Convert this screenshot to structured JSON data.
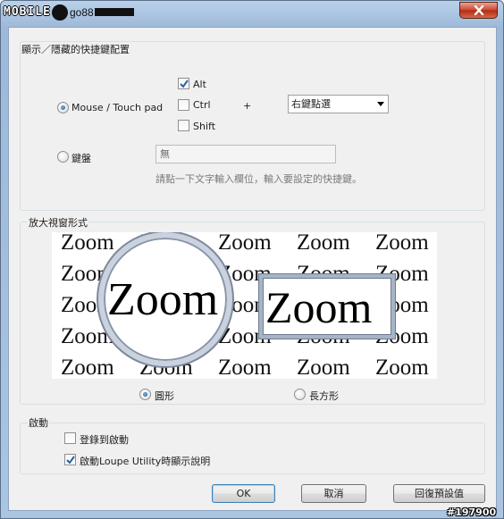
{
  "titlebar": {
    "watermark_logo": "MOBILE",
    "watermark_user": "go88"
  },
  "hotkey_group": {
    "title": "顯示／隱藏的快捷鍵配置",
    "mouse_option": "Mouse / Touch pad",
    "modifiers": [
      {
        "label": "Alt",
        "checked": true
      },
      {
        "label": "Ctrl",
        "checked": false
      },
      {
        "label": "Shift",
        "checked": false
      }
    ],
    "plus": "+",
    "mouse_button": "右鍵點選",
    "keyboard_option": "鍵盤",
    "keyboard_value": "無",
    "keyboard_hint": "請點一下文字輸入欄位，輸入要設定的快捷鍵。"
  },
  "window_style_group": {
    "title": "放大視窗形式",
    "preview_word": "Zoom",
    "circle_option": "圓形",
    "rect_option": "長方形"
  },
  "startup_group": {
    "title": "啟動",
    "register_startup": {
      "label": "登錄到啟動",
      "checked": false
    },
    "show_help": {
      "label": "啟動Loupe Utility時顯示說明",
      "checked": true
    }
  },
  "buttons": {
    "ok": "OK",
    "cancel": "取消",
    "restore_defaults": "回復預設值"
  },
  "corner_badge": "#197900"
}
